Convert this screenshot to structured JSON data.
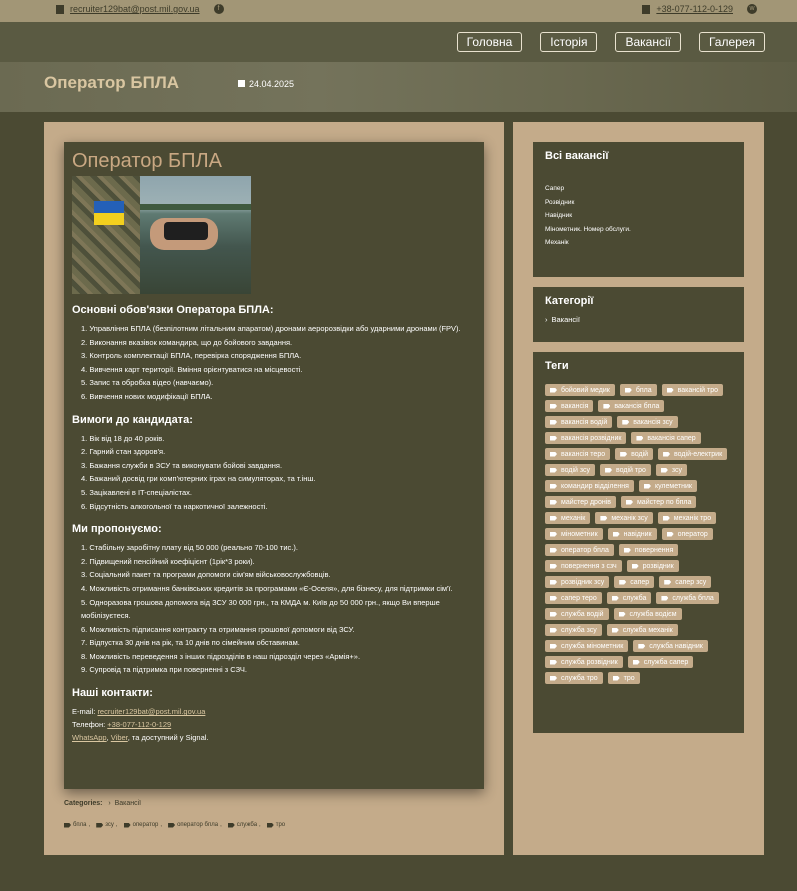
{
  "topbar": {
    "email": "recruiter129bat@post.mil.gov.ua",
    "phone": "+38-077-112-0-129"
  },
  "nav": [
    "Головна",
    "Історія",
    "Вакансії",
    "Галерея"
  ],
  "hero": {
    "title": "Оператор БПЛА",
    "date": "24.04.2025"
  },
  "post": {
    "title": "Оператор БПЛА",
    "duties_heading": "Основні обов'язки Оператора БПЛА:",
    "duties": [
      "1. Управління БПЛА (безпілотним літальним апаратом) дронами аеророзвідки або ударними дронами (FPV).",
      "2. Виконання вказівок командира, що до бойового завдання.",
      "3. Контроль комплектації БПЛА, перевірка спорядження БПЛА.",
      "4. Вивчення карт території. Вміння орієнтуватися на місцевості.",
      "5. Запис та обробка відео (навчаємо).",
      "6. Вивчення нових модифікації БПЛА."
    ],
    "reqs_heading": "Вимоги до кандидата:",
    "reqs": [
      "1. Вік від 18 до 40 років.",
      "2. Гарний стан здоров'я.",
      "3. Бажання служби в ЗСУ та виконувати бойові завдання.",
      "4. Бажаний досвід гри комп'ютерних іграх на симуляторах, та т.інш.",
      "5. Зацікавлені в IT-спеціалістах.",
      "6. Відсутність алкогольної та наркотичної залежності."
    ],
    "offer_heading": "Ми пропонуємо:",
    "offer": [
      "1. Стабільну заробітну плату від 50 000 (реально 70-100 тис.).",
      "2. Підвищений пенсійний коефіцієнт (1рік*3 роки).",
      "3. Соціальний пакет та програми допомоги сім'ям військовослужбовців.",
      "4. Можливість отримання банківських кредитів за програмами «Є-Оселя», для бізнесу, для підтримки сім'ї.",
      "5. Одноразова грошова допомога від ЗСУ 30 000 грн., та КМДА м. Київ до 50 000 грн., якщо Ви вперше мобілізуєтеся.",
      "6. Можливість підписання контракту та отримання грошової допомоги від ЗСУ.",
      "7. Відпустка 30 днів на рік, та 10 днів по сімейним обставинам.",
      "8. Можливість переведення з інших підрозділів в наш підрозділ через «Армія+».",
      "9. Супровід та підтримка при поверненні з СЗЧ."
    ],
    "contacts_heading": "Наші контакти:",
    "email_label": "E-mail:",
    "email": "recruiter129bat@post.mil.gov.ua",
    "phone_label": "Телефон:",
    "phone": "+38-077-112-0-129",
    "messengers_whatsapp": "WhatsApp",
    "messengers_viber": "Viber",
    "messengers_rest": ", та доступний у Signal."
  },
  "footer": {
    "categories_label": "Categories:",
    "category": "Вакансії",
    "tags": [
      "бпла",
      "зсу",
      "оператор",
      "оператор бпла",
      "служба",
      "тро"
    ]
  },
  "sidebar": {
    "all_vacancies_title": "Всі вакансії",
    "vacancies": [
      "Сапер",
      "Розвідник",
      "Навідник",
      "Мінометник. Номер обслуги.",
      "Механік"
    ],
    "categories_title": "Категорії",
    "categories": [
      "Вакансії"
    ],
    "tags_title": "Теги",
    "tags": [
      "бойовий медик",
      "бпла",
      "вакансій тро",
      "вакансія",
      "вакансія бпла",
      "вакансія водій",
      "вакансія зсу",
      "вакансія розвідник",
      "вакансія сапер",
      "вакансія теро",
      "водій",
      "водій-електрик",
      "водій зсу",
      "водій тро",
      "зсу",
      "командир відділення",
      "кулеметник",
      "майстер дронів",
      "майстер по бпла",
      "механік",
      "механік зсу",
      "механік тро",
      "мінометник",
      "навідник",
      "оператор",
      "оператор бпла",
      "повернення",
      "повернення з сзч",
      "розвідник",
      "розвідник зсу",
      "сапер",
      "сапер зсу",
      "сапер теро",
      "служба",
      "служба бпла",
      "служба водій",
      "служба водієм",
      "служба зсу",
      "служба механік",
      "служба мінометник",
      "служба навідник",
      "служба розвідник",
      "служба сапер",
      "служба тро",
      "тро"
    ]
  }
}
